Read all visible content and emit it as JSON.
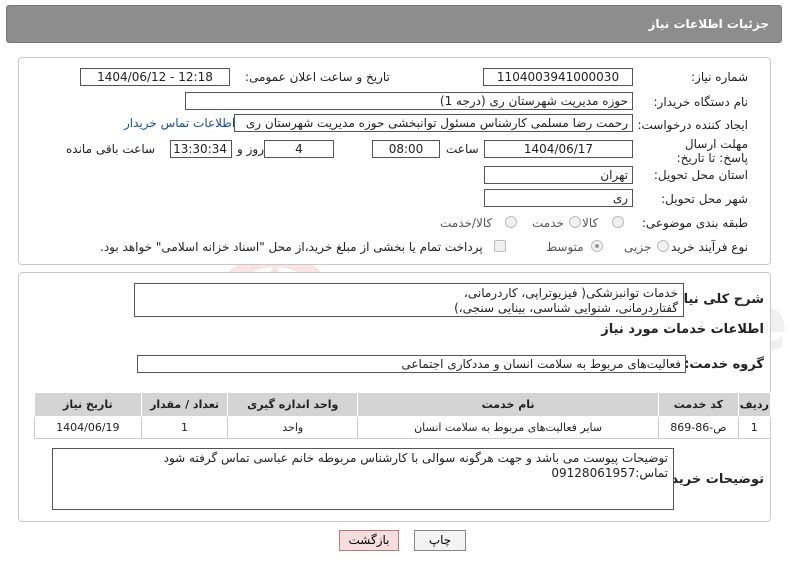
{
  "header": {
    "title": "جزئیات اطلاعات نیاز"
  },
  "form": {
    "need_number_label": "شماره نیاز:",
    "need_number": "1104003941000030",
    "announce_label": "تاریخ و ساعت اعلان عمومی:",
    "announce_value": "1404/06/12 - 12:18",
    "buyer_org_label": "نام دستگاه خریدار:",
    "buyer_org": "حوزه مدیریت   شهرستان ری (درجه 1)",
    "creator_label": "ایجاد کننده درخواست:",
    "creator": "رحمت رضا مسلمی کارشناس مسئول توانبخشی حوزه مدیریت   شهرستان ری",
    "buyer_contact_link": "اطلاعات تماس خریدار",
    "deadline_label": "مهلت ارسال پاسخ: تا تاریخ:",
    "deadline_date": "1404/06/17",
    "time_label": "ساعت",
    "deadline_time": "08:00",
    "days_value": "4",
    "days_label": "روز و",
    "remaining_time": "13:30:34",
    "remaining_label": "ساعت باقی مانده",
    "province_label": "استان محل تحویل:",
    "province": "تهران",
    "city_label": "شهر محل تحویل:",
    "city": "ری",
    "category_label": "طبقه بندی موضوعی:",
    "category_options": [
      "کالا",
      "خدمت",
      "کالا/خدمت"
    ],
    "process_label": "نوع فرآیند خرید :",
    "process_options": [
      "جزیی",
      "متوسط"
    ],
    "payment_note": "پرداخت تمام یا بخشی از مبلغ خرید،از محل \"اسناد خزانه اسلامی\" خواهد بود."
  },
  "details": {
    "summary_label": "شرح کلی نیاز:",
    "summary_line1": "خدمات توانبزشکی( فیزیوتراپی، کاردرمانی،",
    "summary_line2": "گفتاردرمانی، شنوایی شناسی، بینایی سنجی،)",
    "services_heading": "اطلاعات خدمات مورد نیاز",
    "service_group_label": "گروه خدمت:",
    "service_group": "فعالیت‌های مربوط به سلامت انسان و مددکاری اجتماعی",
    "table": {
      "headers": [
        "ردیف",
        "کد خدمت",
        "نام خدمت",
        "واحد اندازه گیری",
        "تعداد / مقدار",
        "تاریخ نیاز"
      ],
      "rows": [
        [
          "1",
          "ص-86-869",
          "سایر فعالیت‌های مربوط به سلامت انسان",
          "واحد",
          "1",
          "1404/06/19"
        ]
      ]
    },
    "buyer_notes_label": "توضیحات خریدار:",
    "buyer_notes_line1": "توضیحات پیوست می باشد و جهت هرگونه سوالی با کارشناس مربوطه خانم عباسی تماس گرفته شود",
    "buyer_notes_line2": "تماس:09128061957"
  },
  "buttons": {
    "print": "چاپ",
    "back": "بازگشت"
  },
  "watermark": {
    "text": "AriaTender.neT"
  },
  "colors": {
    "header_bg": "#8d8d8d",
    "table_header_bg": "#d4d4d4",
    "link": "#1a4fa0",
    "back_button_bg": "#f7dede"
  }
}
